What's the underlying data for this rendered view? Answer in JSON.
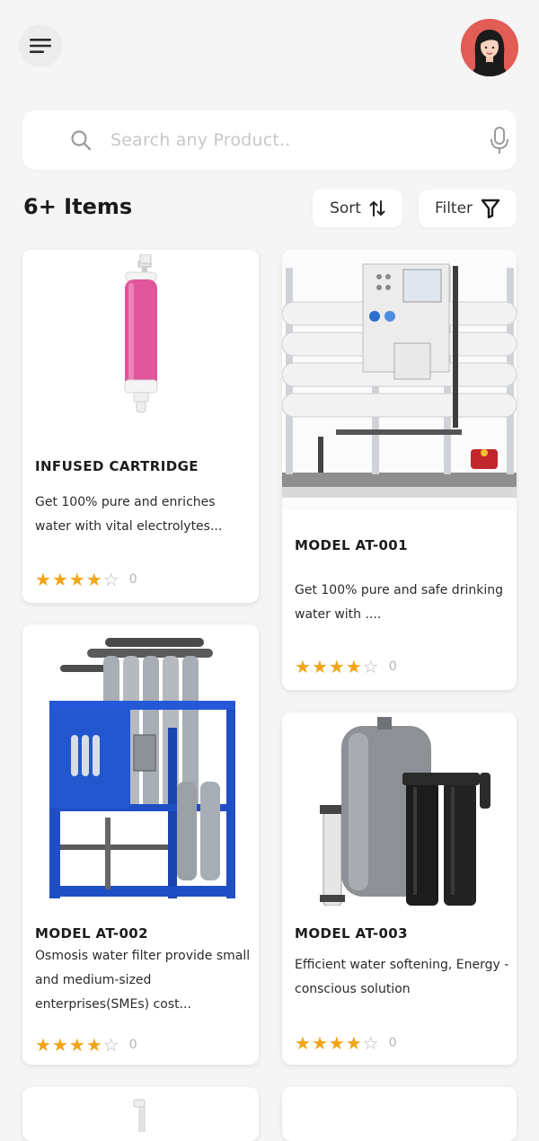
{
  "search": {
    "placeholder": "Search any Product.."
  },
  "items_count": "6+ Items",
  "controls": {
    "sort_label": "Sort",
    "filter_label": "Filter"
  },
  "products": [
    {
      "title": "INFUSED  CARTRIDGE",
      "description": "Get 100% pure and enriches water with vital electrolytes...",
      "rating": 4,
      "reviews": "0",
      "image": "pink-water-cartridge"
    },
    {
      "title": "MODEL AT-001",
      "description": "Get 100% pure and safe drinking water with ....",
      "rating": 4,
      "reviews": "0",
      "image": "industrial-ro-plant"
    },
    {
      "title": "MODEL AT-002",
      "description": "Osmosis water filter provide small and medium-sized enterprises(SMEs) cost...",
      "rating": 4,
      "reviews": "0",
      "image": "blue-frame-ro-system"
    },
    {
      "title": "MODEL AT-003",
      "description": "Efficient water softening, Energy - conscious solution",
      "rating": 4,
      "reviews": "0",
      "image": "grey-tank-water-softener"
    }
  ],
  "colors": {
    "background": "#f5f5f5",
    "card": "#ffffff",
    "star": "#f1a417",
    "avatar_bg": "#e25d55",
    "frame_blue": "#1f4fc4",
    "cartridge_pink": "#e0559c"
  }
}
